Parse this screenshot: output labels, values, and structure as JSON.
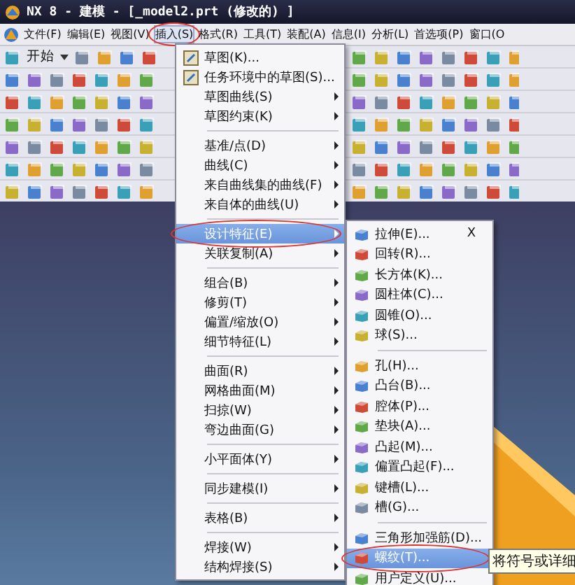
{
  "window": {
    "title": "NX 8 - 建模 - [_model2.prt (修改的) ]"
  },
  "menubar": [
    {
      "label": "文件(F)",
      "selected": false,
      "circled": false
    },
    {
      "label": "编辑(E)",
      "selected": false,
      "circled": false
    },
    {
      "label": "视图(V)",
      "selected": false,
      "circled": false
    },
    {
      "label": "插入(S)",
      "selected": true,
      "circled": true
    },
    {
      "label": "格式(R)",
      "selected": false,
      "circled": false
    },
    {
      "label": "工具(T)",
      "selected": false,
      "circled": false
    },
    {
      "label": "装配(A)",
      "selected": false,
      "circled": false
    },
    {
      "label": "信息(I)",
      "selected": false,
      "circled": false
    },
    {
      "label": "分析(L)",
      "selected": false,
      "circled": false
    },
    {
      "label": "首选项(P)",
      "selected": false,
      "circled": false
    },
    {
      "label": "窗口(O",
      "selected": false,
      "circled": false
    }
  ],
  "toolbar": {
    "start_label": "开始"
  },
  "insert_menu": {
    "items": [
      {
        "kind": "item",
        "label": "草图(K)...",
        "has_icon": true,
        "submenu": false,
        "selected": false,
        "circled": false
      },
      {
        "kind": "item",
        "label": "任务环境中的草图(S)...",
        "has_icon": true,
        "submenu": false,
        "selected": false,
        "circled": false
      },
      {
        "kind": "item",
        "label": "草图曲线(S)",
        "has_icon": false,
        "submenu": true,
        "selected": false,
        "circled": false
      },
      {
        "kind": "item",
        "label": "草图约束(K)",
        "has_icon": false,
        "submenu": true,
        "selected": false,
        "circled": false
      },
      {
        "kind": "separator"
      },
      {
        "kind": "item",
        "label": "基准/点(D)",
        "has_icon": false,
        "submenu": true,
        "selected": false,
        "circled": false
      },
      {
        "kind": "item",
        "label": "曲线(C)",
        "has_icon": false,
        "submenu": true,
        "selected": false,
        "circled": false
      },
      {
        "kind": "item",
        "label": "来自曲线集的曲线(F)",
        "has_icon": false,
        "submenu": true,
        "selected": false,
        "circled": false
      },
      {
        "kind": "item",
        "label": "来自体的曲线(U)",
        "has_icon": false,
        "submenu": true,
        "selected": false,
        "circled": false
      },
      {
        "kind": "separator"
      },
      {
        "kind": "item",
        "label": "设计特征(E)",
        "has_icon": false,
        "submenu": true,
        "selected": true,
        "circled": true
      },
      {
        "kind": "item",
        "label": "关联复制(A)",
        "has_icon": false,
        "submenu": true,
        "selected": false,
        "circled": false
      },
      {
        "kind": "separator"
      },
      {
        "kind": "item",
        "label": "组合(B)",
        "has_icon": false,
        "submenu": true,
        "selected": false,
        "circled": false
      },
      {
        "kind": "item",
        "label": "修剪(T)",
        "has_icon": false,
        "submenu": true,
        "selected": false,
        "circled": false
      },
      {
        "kind": "item",
        "label": "偏置/缩放(O)",
        "has_icon": false,
        "submenu": true,
        "selected": false,
        "circled": false
      },
      {
        "kind": "item",
        "label": "细节特征(L)",
        "has_icon": false,
        "submenu": true,
        "selected": false,
        "circled": false
      },
      {
        "kind": "separator"
      },
      {
        "kind": "item",
        "label": "曲面(R)",
        "has_icon": false,
        "submenu": true,
        "selected": false,
        "circled": false
      },
      {
        "kind": "item",
        "label": "网格曲面(M)",
        "has_icon": false,
        "submenu": true,
        "selected": false,
        "circled": false
      },
      {
        "kind": "item",
        "label": "扫掠(W)",
        "has_icon": false,
        "submenu": true,
        "selected": false,
        "circled": false
      },
      {
        "kind": "item",
        "label": "弯边曲面(G)",
        "has_icon": false,
        "submenu": true,
        "selected": false,
        "circled": false
      },
      {
        "kind": "separator"
      },
      {
        "kind": "item",
        "label": "小平面体(Y)",
        "has_icon": false,
        "submenu": true,
        "selected": false,
        "circled": false
      },
      {
        "kind": "separator"
      },
      {
        "kind": "item",
        "label": "同步建模(I)",
        "has_icon": false,
        "submenu": true,
        "selected": false,
        "circled": false
      },
      {
        "kind": "separator"
      },
      {
        "kind": "item",
        "label": "表格(B)",
        "has_icon": false,
        "submenu": true,
        "selected": false,
        "circled": false
      },
      {
        "kind": "separator"
      },
      {
        "kind": "item",
        "label": "焊接(W)",
        "has_icon": false,
        "submenu": true,
        "selected": false,
        "circled": false
      },
      {
        "kind": "item",
        "label": "结构焊接(S)",
        "has_icon": false,
        "submenu": true,
        "selected": false,
        "circled": false
      }
    ]
  },
  "design_feature_menu": {
    "items": [
      {
        "kind": "item",
        "label": "拉伸(E)...",
        "shortcut": "X",
        "has_icon": true,
        "selected": false,
        "circled": false
      },
      {
        "kind": "item",
        "label": "回转(R)...",
        "has_icon": true,
        "selected": false,
        "circled": false
      },
      {
        "kind": "item",
        "label": "长方体(K)...",
        "has_icon": true,
        "selected": false,
        "circled": false
      },
      {
        "kind": "item",
        "label": "圆柱体(C)...",
        "has_icon": true,
        "selected": false,
        "circled": false
      },
      {
        "kind": "item",
        "label": "圆锥(O)...",
        "has_icon": true,
        "selected": false,
        "circled": false
      },
      {
        "kind": "item",
        "label": "球(S)...",
        "has_icon": true,
        "selected": false,
        "circled": false
      },
      {
        "kind": "separator"
      },
      {
        "kind": "item",
        "label": "孔(H)...",
        "has_icon": true,
        "selected": false,
        "circled": false
      },
      {
        "kind": "item",
        "label": "凸台(B)...",
        "has_icon": true,
        "selected": false,
        "circled": false
      },
      {
        "kind": "item",
        "label": "腔体(P)...",
        "has_icon": true,
        "selected": false,
        "circled": false
      },
      {
        "kind": "item",
        "label": "垫块(A)...",
        "has_icon": true,
        "selected": false,
        "circled": false
      },
      {
        "kind": "item",
        "label": "凸起(M)...",
        "has_icon": true,
        "selected": false,
        "circled": false
      },
      {
        "kind": "item",
        "label": "偏置凸起(F)...",
        "has_icon": true,
        "selected": false,
        "circled": false
      },
      {
        "kind": "item",
        "label": "键槽(L)...",
        "has_icon": true,
        "selected": false,
        "circled": false
      },
      {
        "kind": "item",
        "label": "槽(G)...",
        "has_icon": true,
        "selected": false,
        "circled": false
      },
      {
        "kind": "separator"
      },
      {
        "kind": "item",
        "label": "三角形加强筋(D)...",
        "has_icon": true,
        "selected": false,
        "circled": false
      },
      {
        "kind": "item",
        "label": "螺纹(T)...",
        "has_icon": true,
        "selected": true,
        "circled": true
      },
      {
        "kind": "item",
        "label": "用户定义(U)...",
        "has_icon": true,
        "selected": false,
        "circled": false
      }
    ]
  },
  "tooltip": {
    "text": "将符号或详细"
  }
}
